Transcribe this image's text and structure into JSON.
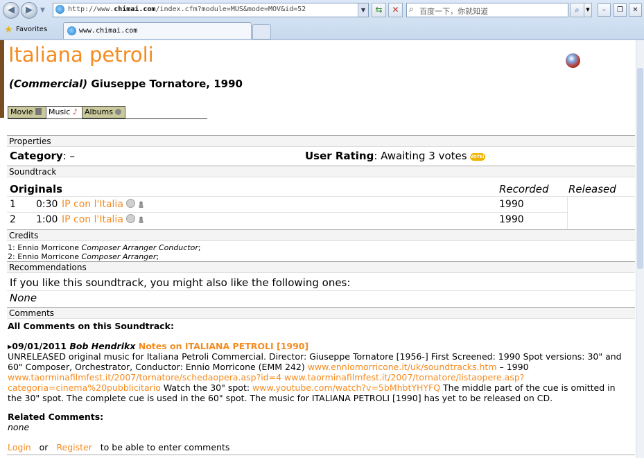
{
  "browser": {
    "url_prefix": "http://www.",
    "url_domain": "chimai.com",
    "url_rest": "/index.cfm?module=MUS&mode=MOV&id=52",
    "search_placeholder": "百度一下，你就知道",
    "favorites_label": "Favorites",
    "tab_title": "www.chimai.com"
  },
  "page": {
    "title": "Italiana petroli",
    "subtitle_type": "(Commercial)",
    "subtitle_rest": " Giuseppe Tornatore, 1990",
    "tabs": [
      "Movie",
      "Music",
      "Albums"
    ]
  },
  "properties": {
    "header": "Properties",
    "category_label": "Category",
    "category_value": ": –",
    "rating_label": "User Rating",
    "rating_value": ": Awaiting 3 votes",
    "vote_badge": "VOTE!"
  },
  "soundtrack": {
    "header": "Soundtrack",
    "originals_label": "Originals",
    "recorded_label": "Recorded",
    "released_label": "Released",
    "tracks": [
      {
        "num": "1",
        "time": "0:30",
        "title": "IP con l'Italia",
        "recorded": "1990"
      },
      {
        "num": "2",
        "time": "1:00",
        "title": "IP con l'Italia",
        "recorded": "1990"
      }
    ]
  },
  "credits": {
    "header": "Credits",
    "lines": [
      {
        "prefix": "1: Ennio Morricone ",
        "roles": "Composer Arranger Conductor",
        "suffix": ";"
      },
      {
        "prefix": "2: Ennio Morricone ",
        "roles": "Composer Arranger",
        "suffix": ";"
      }
    ]
  },
  "recommendations": {
    "header": "Recommendations",
    "text": "If you like this soundtrack, you might also like the following ones:",
    "none": "None"
  },
  "comments": {
    "header": "Comments",
    "all_label": "All Comments on this Soundtrack:",
    "date": "09/01/2011",
    "author": "Bob Hendrikx",
    "comment_title": "Notes on ITALIANA PETROLI [1990]",
    "body1": "UNRELEASED original music for Italiana Petroli Commercial. Director: Giuseppe Tornatore [1956-] First Screened: 1990 Spot versions: 30\" and 60\" Composer, Orchestrator, Conductor: Ennio Morricone (EMM 242) ",
    "link1": "www.enniomorricone.it/uk/soundtracks.htm",
    "body2": " – 1990 ",
    "link2": "www.taorminafilmfest.it/2007/tornatore/schedaopera.asp?id=4",
    "body3": " ",
    "link3": "www.taorminafilmfest.it/2007/tornatore/listaopere.asp?categoria=cinema%20pubblicitario",
    "body4": " Watch the 30\" spot: ",
    "link4": "www.youtube.com/watch?v=5bMhbtYHYFQ",
    "body5": " The middle part of the cue is omitted in the 30\" spot. The complete cue is used in the 60\" spot. The music for ITALIANA PETROLI [1990] has yet to be released on CD.",
    "related_label": "Related Comments:",
    "related_none": "none",
    "login": "Login",
    "or": "or",
    "register": "Register",
    "enter_text": "to be able to enter comments"
  }
}
